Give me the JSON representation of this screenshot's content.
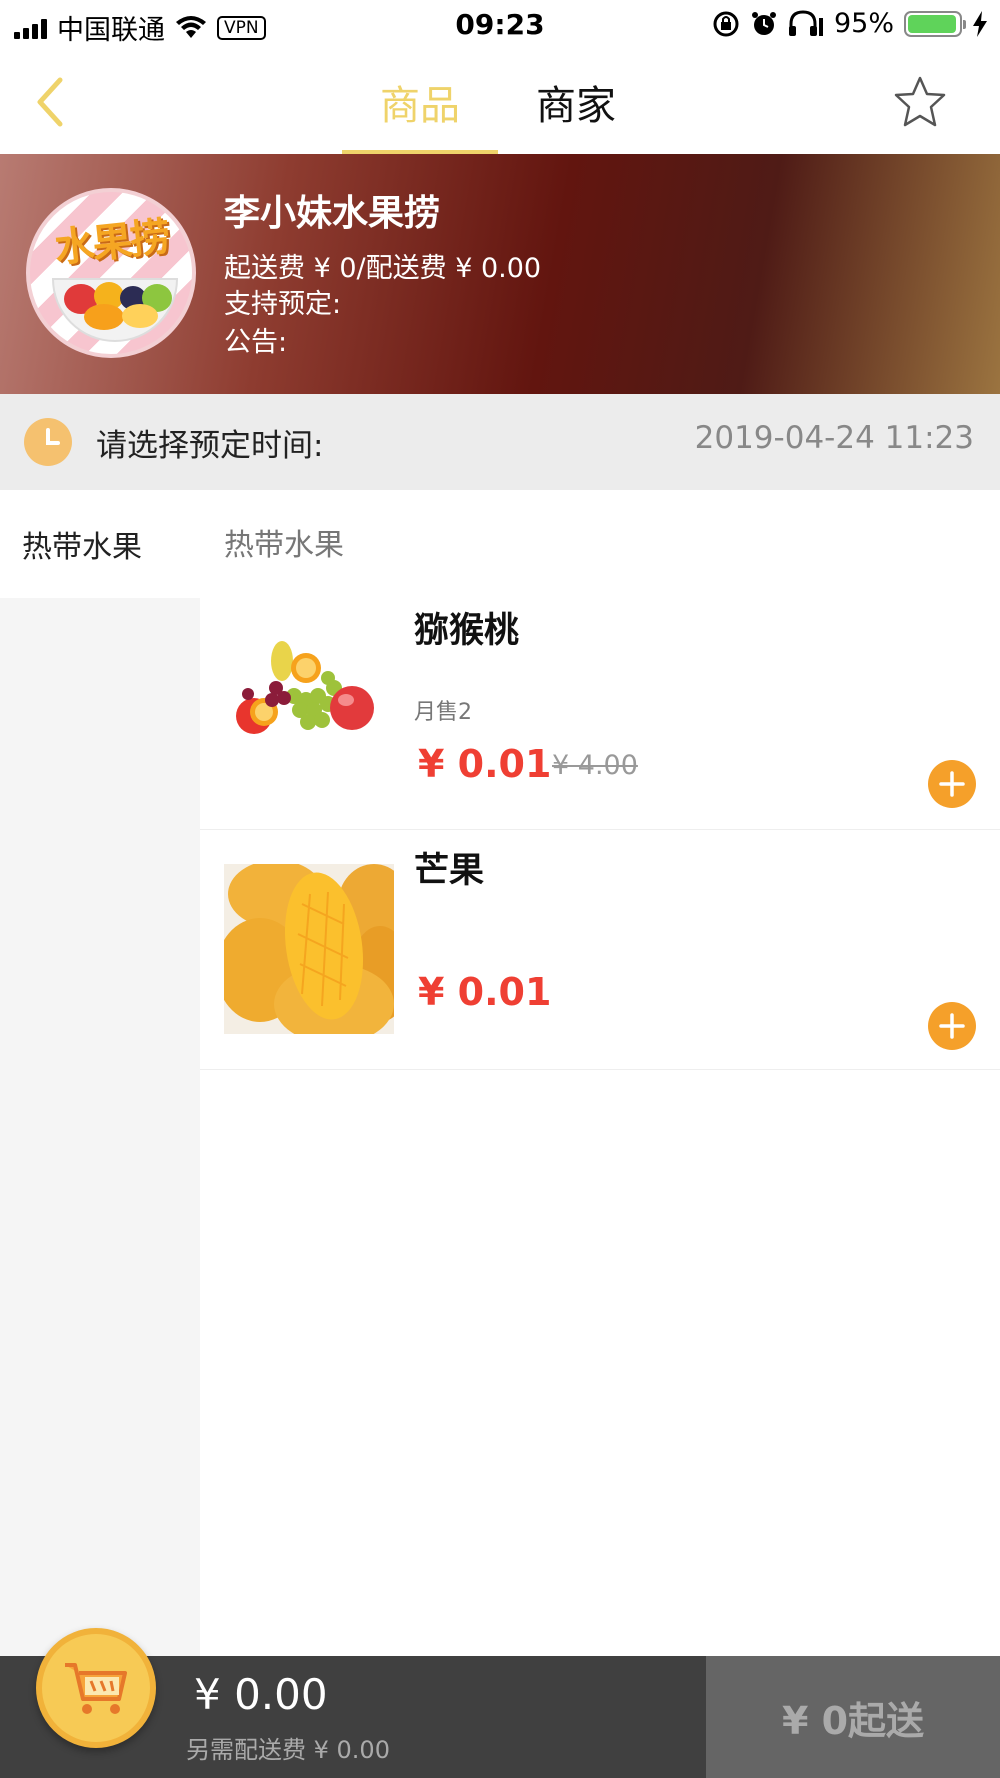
{
  "status_bar": {
    "carrier": "中国联通",
    "vpn": "VPN",
    "time": "09:23",
    "battery": "95%",
    "battery_level": 0.95
  },
  "nav": {
    "tabs": [
      {
        "label": "商品",
        "active": true
      },
      {
        "label": "商家",
        "active": false
      }
    ],
    "accent_color": "#efd36a"
  },
  "store": {
    "name": "李小妹水果捞",
    "fees": "起送费 ¥ 0/配送费 ¥ 0.00",
    "reservation_support": "支持预定:",
    "notice": "公告:",
    "logo_text": "水果捞"
  },
  "reservation": {
    "label": "请选择预定时间:",
    "time": "2019-04-24 11:23"
  },
  "categories": [
    {
      "label": "热带水果",
      "active": true
    }
  ],
  "section_title": "热带水果",
  "products": [
    {
      "name": "猕猴桃",
      "sold": "月售2",
      "price": "¥ 0.01",
      "original_price": "¥ 4.00",
      "image": "mixed-fruit"
    },
    {
      "name": "芒果",
      "sold": "",
      "price": "¥ 0.01",
      "original_price": "",
      "image": "mango"
    }
  ],
  "cart": {
    "total": "¥ 0.00",
    "delivery_note": "另需配送费 ¥ 0.00",
    "checkout_label": "¥ 0起送"
  },
  "colors": {
    "price": "#ef3f33",
    "add_button": "#f5a02a",
    "bottom_bar": "#404040"
  }
}
